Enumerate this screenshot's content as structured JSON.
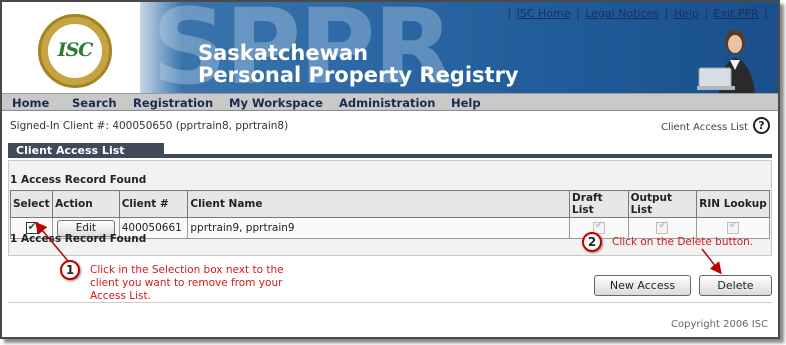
{
  "banner": {
    "logo_text": "ISC",
    "watermark": "SPPR",
    "title_line1": "Saskatchewan",
    "title_line2": "Personal Property Registry"
  },
  "top_links": [
    "ISC Home",
    "Legal Notices",
    "Help",
    "Exit PPR"
  ],
  "nav": [
    "Home",
    "Search",
    "Registration",
    "My Workspace",
    "Administration",
    "Help"
  ],
  "signed_in": "Signed-In Client #: 400050650 (pprtrain8, pprtrain8)",
  "page_link": "Client Access List",
  "help_icon": "?",
  "section_title": "Client Access List",
  "records_found_top": "1 Access Record Found",
  "records_found_bottom": "1 Access Record Found",
  "table": {
    "headers": {
      "select": "Select",
      "action": "Action",
      "client_no": "Client #",
      "client_name": "Client Name",
      "draft_list": "Draft List",
      "output_list": "Output List",
      "rin_lookup": "RIN Lookup"
    },
    "rows": [
      {
        "selected": true,
        "action_label": "Edit",
        "client_no": "400050661",
        "client_name": "pprtrain9, pprtrain9",
        "draft_list": true,
        "output_list": true,
        "rin_lookup": true
      }
    ]
  },
  "buttons": {
    "new_access": "New Access",
    "delete": "Delete"
  },
  "callouts": [
    {
      "num": "1",
      "text": "Click in the Selection box next to the client you want to remove from your Access List."
    },
    {
      "num": "2",
      "text": "Click on the Delete button."
    }
  ],
  "copyright": "Copyright 2006 ISC",
  "colors": {
    "banner_blue": "#2e6aa6",
    "nav_bg": "#c9c9c9",
    "tab_bg": "#3f4a5a",
    "callout_red": "#d11a1a",
    "logo_gold": "#c7a443",
    "logo_green": "#2e7a35"
  }
}
